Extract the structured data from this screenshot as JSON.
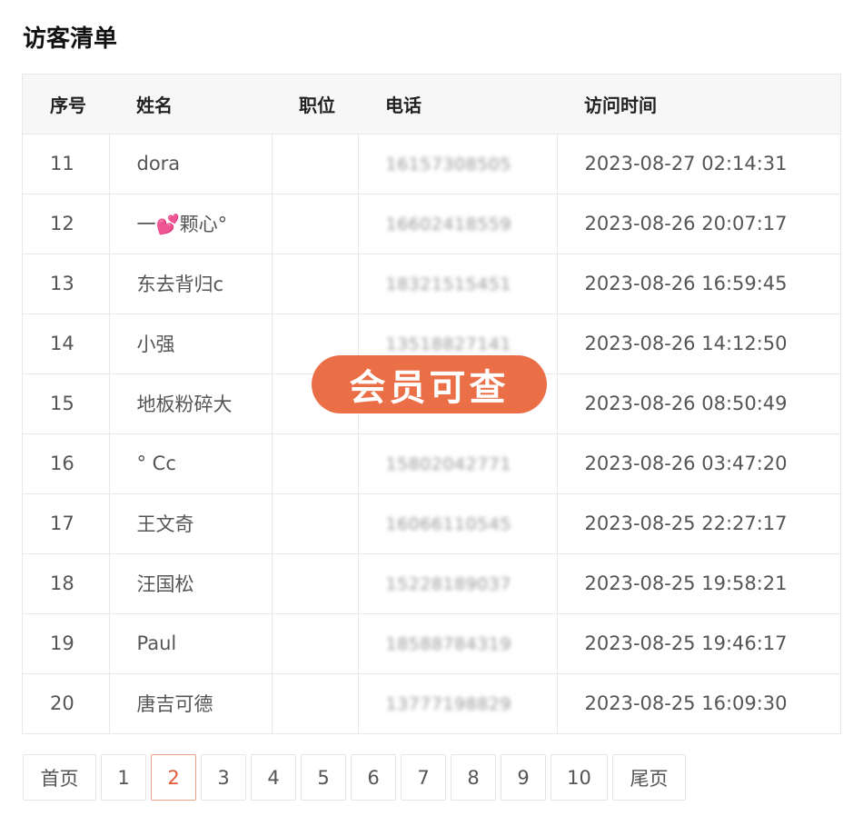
{
  "page_title": "访客清单",
  "table": {
    "headers": [
      "序号",
      "姓名",
      "职位",
      "电话",
      "访问时间"
    ],
    "rows": [
      {
        "no": "11",
        "name": "dora",
        "position": "",
        "phone": "16157308505",
        "time": "2023-08-27 02:14:31"
      },
      {
        "no": "12",
        "name": "一💕颗心°",
        "position": "",
        "phone": "16602418559",
        "time": "2023-08-26 20:07:17"
      },
      {
        "no": "13",
        "name": "东去背归c",
        "position": "",
        "phone": "18321515451",
        "time": "2023-08-26 16:59:45"
      },
      {
        "no": "14",
        "name": "小强",
        "position": "",
        "phone": "13518827141",
        "time": "2023-08-26 14:12:50"
      },
      {
        "no": "15",
        "name": "地板粉碎大",
        "position": "",
        "phone": "",
        "time": "2023-08-26 08:50:49"
      },
      {
        "no": "16",
        "name": "° Cc",
        "position": "",
        "phone": "15802042771",
        "time": "2023-08-26 03:47:20"
      },
      {
        "no": "17",
        "name": "王文奇",
        "position": "",
        "phone": "16066110545",
        "time": "2023-08-25 22:27:17"
      },
      {
        "no": "18",
        "name": "汪国松",
        "position": "",
        "phone": "15228189037",
        "time": "2023-08-25 19:58:21"
      },
      {
        "no": "19",
        "name": "Paul",
        "position": "",
        "phone": "18588784319",
        "time": "2023-08-25 19:46:17"
      },
      {
        "no": "20",
        "name": "唐吉可德",
        "position": "",
        "phone": "13777198829",
        "time": "2023-08-25 16:09:30"
      }
    ]
  },
  "overlay_badge": "会员可查",
  "pagination": {
    "first": "首页",
    "pages": [
      "1",
      "2",
      "3",
      "4",
      "5",
      "6",
      "7",
      "8",
      "9",
      "10"
    ],
    "current": "2",
    "last": "尾页"
  },
  "colors": {
    "badge_bg": "#ea6f47",
    "active_page": "#e05a3a",
    "header_bg": "#f7f7f7"
  }
}
